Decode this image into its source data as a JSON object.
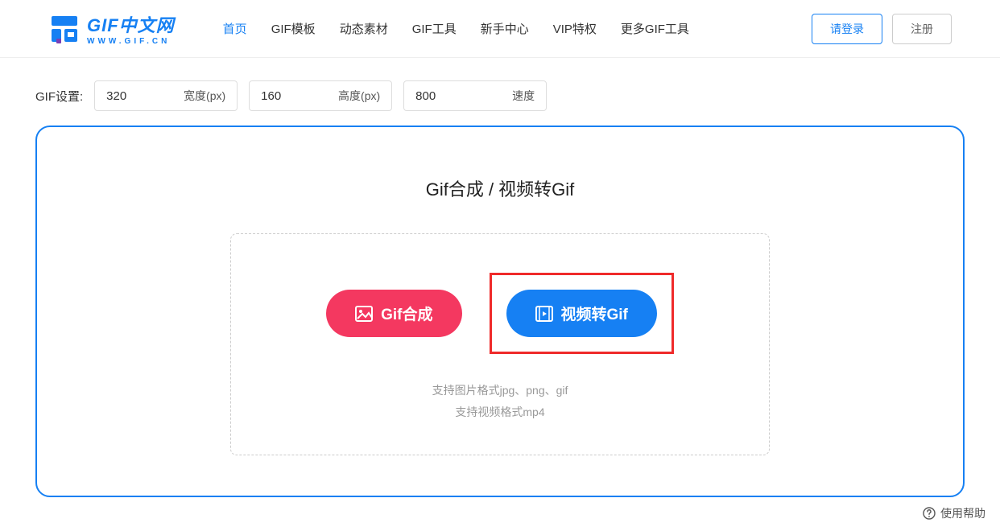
{
  "logo": {
    "main": "GIF中文网",
    "sub": "WWW.GIF.CN"
  },
  "nav": {
    "items": [
      {
        "label": "首页",
        "active": true
      },
      {
        "label": "GIF模板",
        "active": false
      },
      {
        "label": "动态素材",
        "active": false
      },
      {
        "label": "GIF工具",
        "active": false
      },
      {
        "label": "新手中心",
        "active": false
      },
      {
        "label": "VIP特权",
        "active": false
      },
      {
        "label": "更多GIF工具",
        "active": false
      }
    ]
  },
  "auth": {
    "login": "请登录",
    "register": "注册"
  },
  "settings": {
    "label": "GIF设置:",
    "width": {
      "value": "320",
      "suffix": "宽度(px)"
    },
    "height": {
      "value": "160",
      "suffix": "高度(px)"
    },
    "speed": {
      "value": "800",
      "suffix": "速度"
    }
  },
  "panel": {
    "title": "Gif合成 / 视频转Gif",
    "compose_btn": "Gif合成",
    "video_btn": "视频转Gif",
    "support1": "支持图片格式jpg、png、gif",
    "support2": "支持视频格式mp4"
  },
  "footer": {
    "help": "使用帮助"
  }
}
